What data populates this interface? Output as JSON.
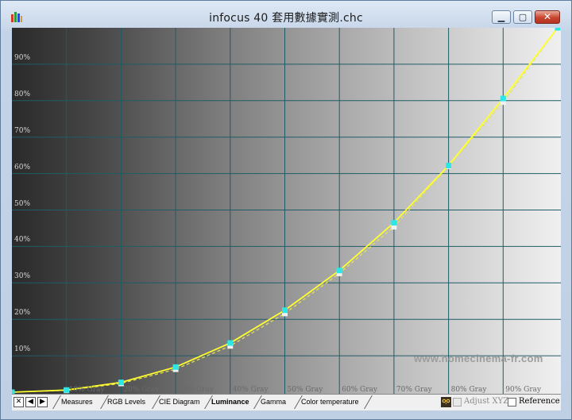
{
  "window": {
    "title": "infocus 40 套用數據實測.chc",
    "controls": {
      "minimize": "▁",
      "maximize": "▢",
      "close": "✕"
    }
  },
  "plot": {
    "watermark": "www.homecinema-fr.com",
    "y_labels": [
      "90%",
      "80%",
      "70%",
      "60%",
      "50%",
      "40%",
      "30%",
      "20%",
      "10%"
    ],
    "x_labels": [
      "10% Gray",
      "20% Gray",
      "30% Gray",
      "40% Gray",
      "50% Gray",
      "60% Gray",
      "70% Gray",
      "80% Gray",
      "90% Gray"
    ]
  },
  "chart_data": {
    "type": "line",
    "x": [
      0,
      10,
      20,
      30,
      40,
      50,
      60,
      70,
      80,
      90,
      100
    ],
    "xlabel": "",
    "ylabel": "",
    "ylim": [
      0,
      100
    ],
    "xlim": [
      0,
      100
    ],
    "grid": true,
    "series": [
      {
        "values": [
          0,
          0.6,
          2.7,
          6.9,
          13.5,
          22.5,
          33.4,
          46.5,
          62.2,
          80.6,
          100
        ],
        "color": "#ffff30",
        "marker": "square-cyan"
      },
      {
        "values": [
          0,
          0.5,
          2.4,
          6.3,
          12.7,
          21.6,
          32.6,
          45.4,
          62.0,
          79.6,
          100
        ],
        "color": "#e8e84a",
        "style": "dashed",
        "marker": "square-white"
      }
    ]
  },
  "bottom": {
    "nav": {
      "close": "✕",
      "prev": "◀",
      "next": "▶"
    },
    "tabs": [
      "Measures",
      "RGB Levels",
      "CIE Diagram",
      "Luminance",
      "Gamma",
      "Color temperature"
    ],
    "active_tab": "Luminance",
    "adjust_label": "Adjust XYZ",
    "reference_label": "Reference"
  },
  "colors": {
    "grid": "#1f5c66",
    "curve": "#ffff30",
    "marker_measured": "#2ee6e6",
    "marker_reference": "#f0f0f0"
  }
}
